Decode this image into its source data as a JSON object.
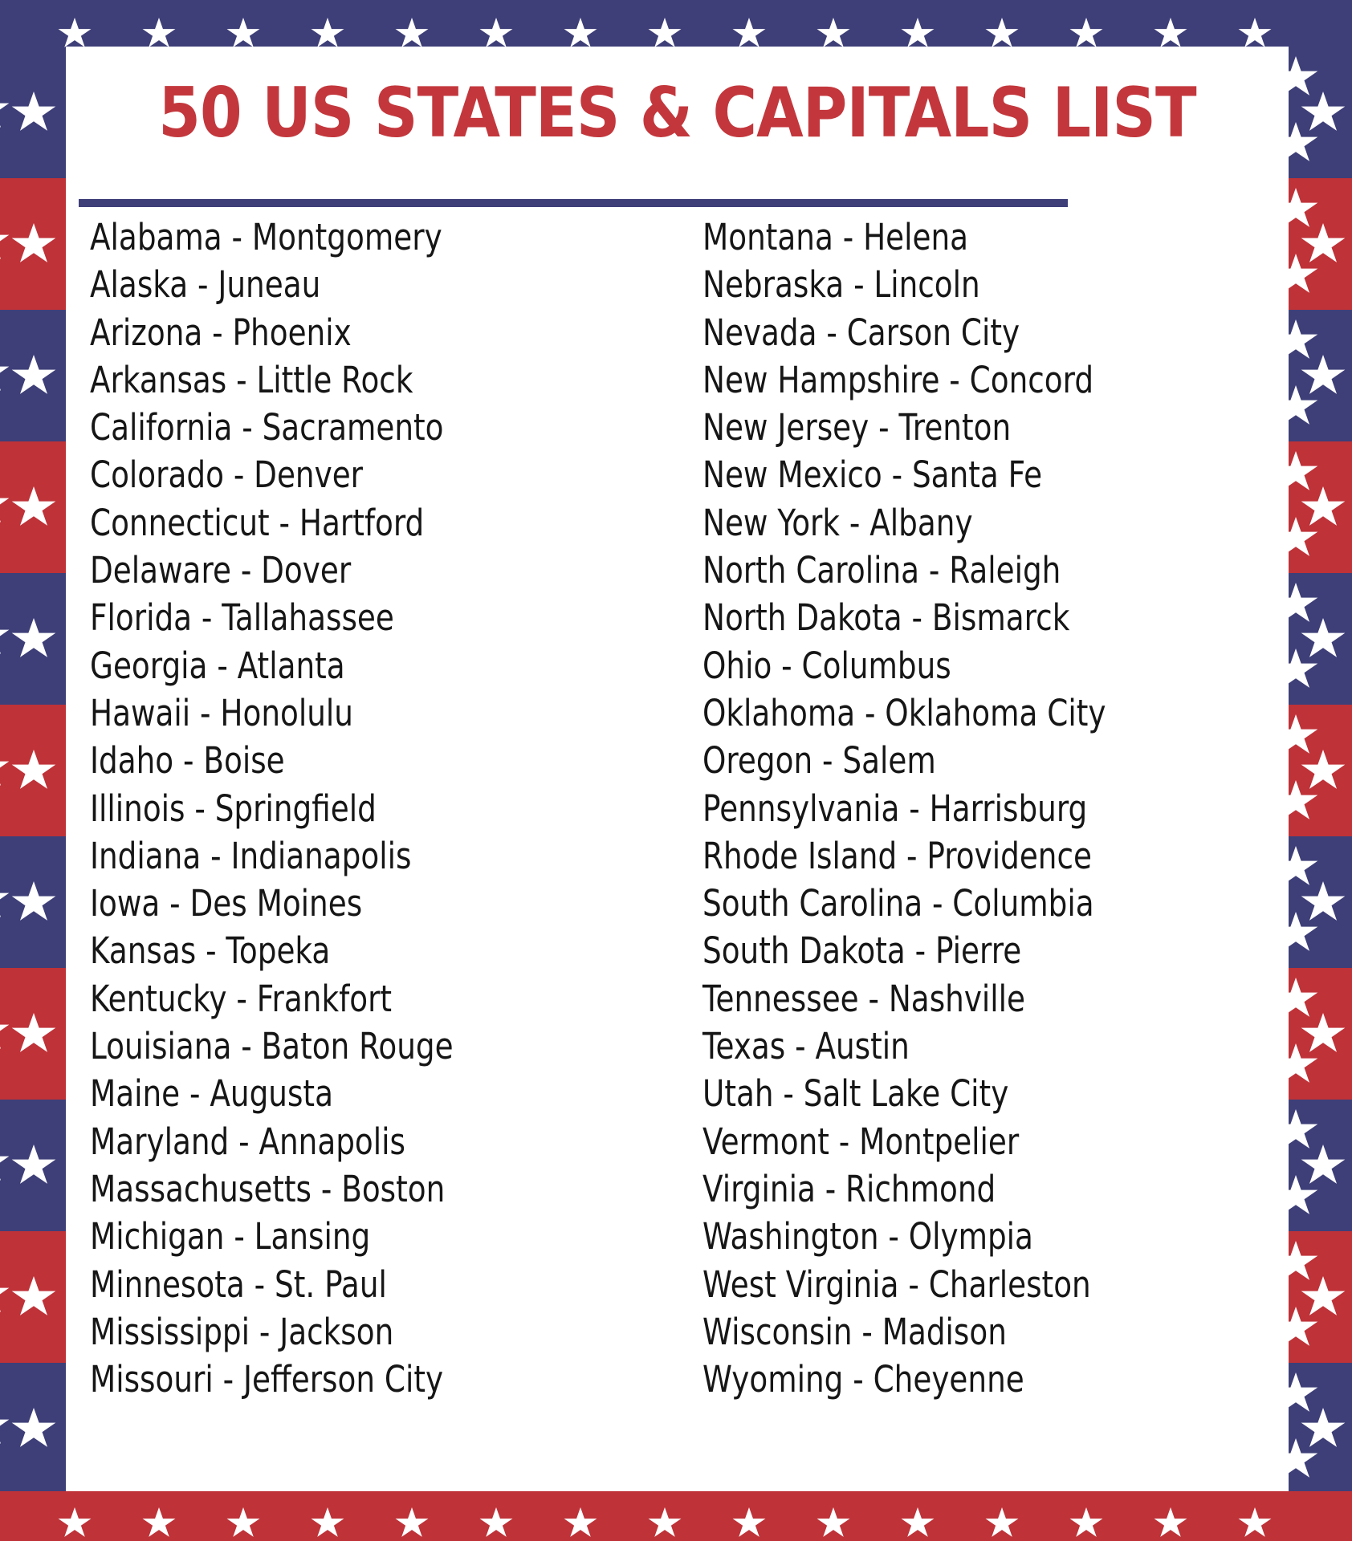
{
  "document": {
    "title": "50 US STATES & CAPITALS LIST"
  },
  "colors": {
    "navy": "#3E3F78",
    "red": "#BF3238",
    "title_red": "#C3373C",
    "star_white": "#FFFFFF",
    "text_black": "#161616",
    "panel_background": "#FFFFFF"
  },
  "border": {
    "top_band_color": "#3E3F78",
    "bottom_band_color": "#BF3238",
    "top_star_count": 15,
    "bottom_star_count": 15,
    "side_block_colors": [
      "#3E3F78",
      "#BF3238",
      "#3E3F78",
      "#BF3238",
      "#3E3F78",
      "#BF3238",
      "#3E3F78",
      "#BF3238",
      "#3E3F78",
      "#BF3238",
      "#3E3F78"
    ],
    "star_icon": "five-pointed-star"
  },
  "list": {
    "column_left": [
      "Alabama - Montgomery",
      "Alaska - Juneau",
      "Arizona - Phoenix",
      "Arkansas - Little Rock",
      "California - Sacramento",
      "Colorado - Denver",
      "Connecticut - Hartford",
      "Delaware - Dover",
      "Florida - Tallahassee",
      "Georgia - Atlanta",
      "Hawaii - Honolulu",
      "Idaho - Boise",
      "Illinois - Springfield",
      "Indiana - Indianapolis",
      "Iowa - Des Moines",
      "Kansas - Topeka",
      "Kentucky - Frankfort",
      "Louisiana - Baton Rouge",
      "Maine - Augusta",
      "Maryland - Annapolis",
      "Massachusetts - Boston",
      "Michigan - Lansing",
      "Minnesota - St. Paul",
      "Mississippi - Jackson",
      "Missouri - Jefferson City"
    ],
    "column_right": [
      "Montana - Helena",
      "Nebraska - Lincoln",
      "Nevada - Carson City",
      "New Hampshire - Concord",
      "New Jersey - Trenton",
      "New Mexico - Santa Fe",
      "New York - Albany",
      "North Carolina - Raleigh",
      "North Dakota - Bismarck",
      "Ohio - Columbus",
      "Oklahoma - Oklahoma City",
      "Oregon - Salem",
      "Pennsylvania - Harrisburg",
      "Rhode Island - Providence",
      "South Carolina - Columbia",
      "South Dakota - Pierre",
      "Tennessee - Nashville",
      "Texas - Austin",
      "Utah - Salt Lake City",
      "Vermont - Montpelier",
      "Virginia - Richmond",
      "Washington - Olympia",
      "West Virginia - Charleston",
      "Wisconsin - Madison",
      "Wyoming - Cheyenne"
    ]
  }
}
